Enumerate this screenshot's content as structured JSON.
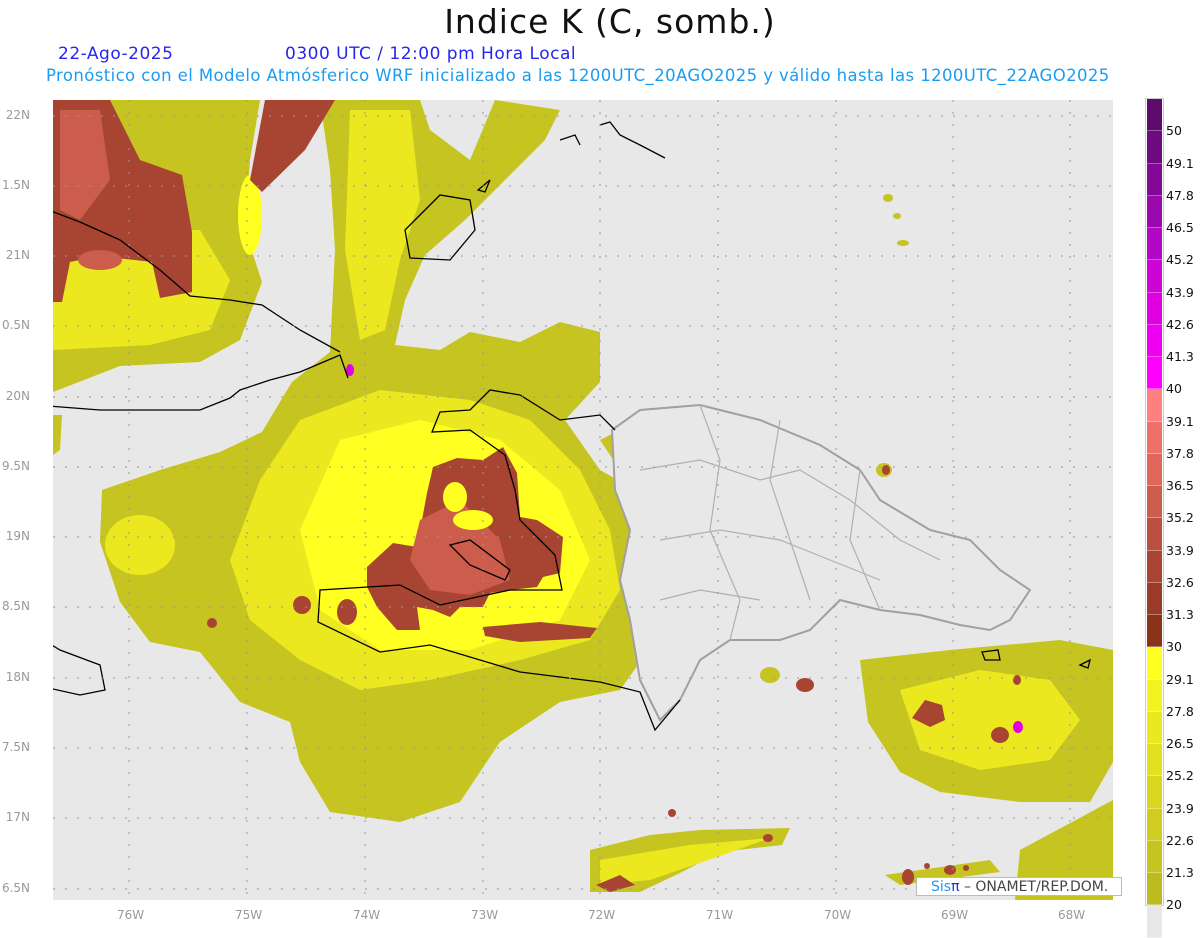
{
  "title": "Indice K (C, somb.)",
  "date": "22-Ago-2025",
  "time": "0300 UTC / 12:00 pm Hora Local",
  "subtitle": "Pronóstico con el Modelo Atmósferico WRF inicializado a las 1200UTC_20AGO2025 y válido hasta las  1200UTC_22AGO2025",
  "credit": {
    "sis": "Sis",
    "pi": "π",
    "rest": " –  ONAMET/REP.DOM."
  },
  "lat_labels": [
    "22N",
    "1.5N",
    "21N",
    "0.5N",
    "20N",
    "9.5N",
    "19N",
    "8.5N",
    "18N",
    "7.5N",
    "17N",
    "6.5N"
  ],
  "lon_labels": [
    "76W",
    "75W",
    "74W",
    "73W",
    "72W",
    "71W",
    "70W",
    "69W",
    "68W"
  ],
  "colorbar": {
    "labels": [
      "50",
      "49.1",
      "47.8",
      "46.5",
      "45.2",
      "43.9",
      "42.6",
      "41.3",
      "40",
      "39.1",
      "37.8",
      "36.5",
      "35.2",
      "33.9",
      "32.6",
      "31.3",
      "30",
      "29.1",
      "27.8",
      "26.5",
      "25.2",
      "23.9",
      "22.6",
      "21.3",
      "20"
    ],
    "colors": [
      "#5c0a6b",
      "#6e0a80",
      "#820898",
      "#9a08ae",
      "#b008c4",
      "#cc05d6",
      "#e000e2",
      "#f000f0",
      "#ff00ff",
      "#ff8080",
      "#ee7068",
      "#e0665a",
      "#cc5c4c",
      "#bb5040",
      "#aa4434",
      "#9a3a28",
      "#8b3318",
      "#ffff22",
      "#f4f220",
      "#ece820",
      "#e3e020",
      "#dad620",
      "#d0cc20",
      "#c6c420",
      "#bcbc20",
      "#e8e8e8"
    ]
  }
}
